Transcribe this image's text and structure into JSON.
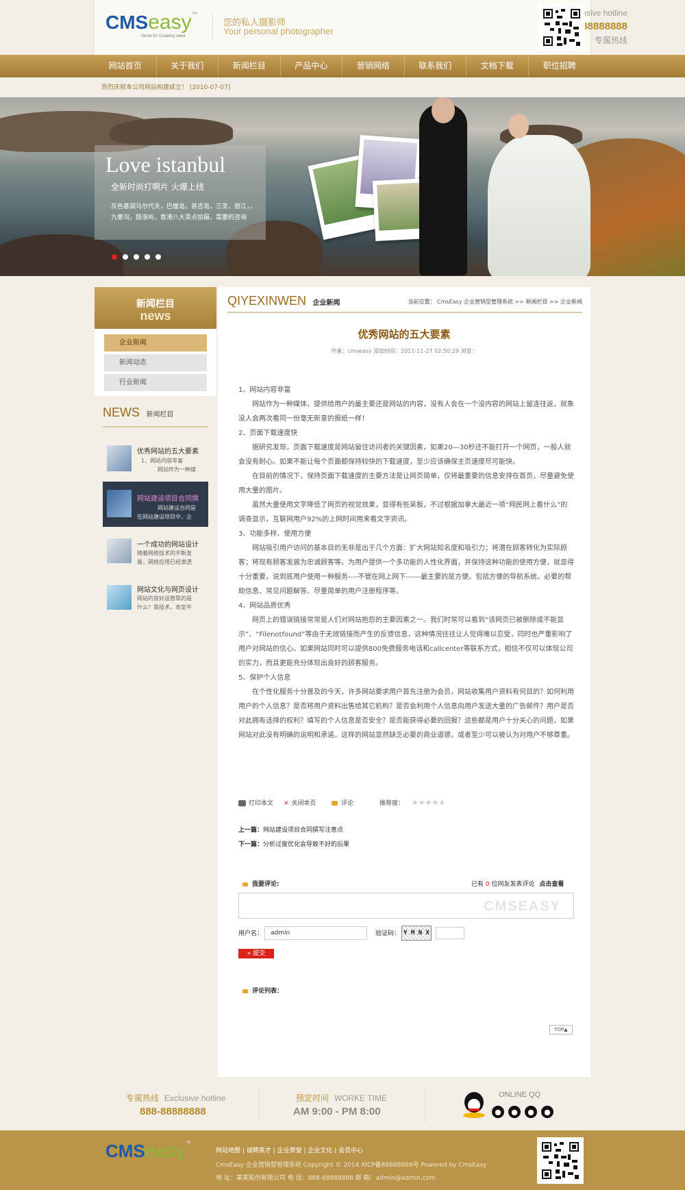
{
  "header": {
    "logo_main": "CMS",
    "logo_accent": "easy",
    "logo_tm": "™",
    "logo_tagline": "Serve for Creating value",
    "slogan_cn": "您的私人摄影师",
    "slogan_en": "Your personal photographer",
    "hotline_en": "Exclusive hotline",
    "hotline_number": "888-88888888",
    "hotline_cn": "专属热线"
  },
  "nav": {
    "items": [
      "网站首页",
      "关于我们",
      "新闻栏目",
      "产品中心",
      "营销网络",
      "联系我们",
      "文档下载",
      "职位招聘"
    ]
  },
  "announcement": "热烈庆祝本公司网站构建成立！ [2010-07-07]",
  "banner": {
    "title": "Love istanbul",
    "subtitle": "全新时尚打啊片 火爆上线",
    "desc1": "灰色基调马尔代夫，巴厘岛，普吉岛，三亚，丽江，，",
    "desc2": "九寨沟，鼓浪屿，香港八大景点拍摄，需要的咨询"
  },
  "sidebar": {
    "title_cn": "新闻栏目",
    "title_en": "news",
    "menu": [
      "企业新闻",
      "新闻动态",
      "行业新闻"
    ],
    "news_en": "NEWS",
    "news_cn": "新闻栏目",
    "news_items": [
      {
        "title": "优秀网站的五大要素",
        "line1": "1、网站内容非富",
        "line2": "网站作为一种媒"
      },
      {
        "title": "网站建设项目合同撰",
        "line1": "网站建设合同是",
        "line2": "在网站建设项目中，企"
      },
      {
        "title": "一个成功的网站设计",
        "line1": "随着网络技术的不断发",
        "line2": "展，网络应用已经渗透"
      },
      {
        "title": "网站文化与网页设计",
        "line1": "网站的良好运营靠的是",
        "line2": "什么？靠技术，肯定不"
      }
    ]
  },
  "content": {
    "heading_en": "QIYEXINWEN",
    "heading_cn": "企业新闻",
    "breadcrumb": "当前位置： CmsEasy 企业营销型管理系统  >> 新闻栏目  >> 企业新闻",
    "article_title": "优秀网站的五大要素",
    "meta": "作者：cmseasy   添加时间：2011-11-27 02:50:29   浏览：",
    "paragraphs": [
      "1、网站内容非富",
      "网站作为一种媒体，提供给用户的最主要还是网站的内容，没有人会在一个没内容的网站上留连往返，就象没人会两次看同一份毫无新意的报纸一样！",
      "2、页面下载速度快",
      "据研究发现，页面下载速度是网站留住访问者的关键因素，如果20—30秒还不能打开一个网页，一般人就会没有耐心。如果不能让每个页面都保持较快的下载速度，至少应该确保主页速度尽可能快。",
      "在目前的情况下，保持页面下载速度的主要方法是让网页简单，仅将最重要的信息安排在首页，尽量避免使用大量的图片。",
      "虽然大量使用文字降低了网页的视觉效果，显得有些呆板，不过根据加拿大最近一项“网民网上看什么”的调查显示，互联网用户92%的上网时间用来看文字资讯。",
      "3、功能多样、使用方便",
      "网站吸引用户访问的基本目的无非是出于几个方面：扩大网站知名度和吸引力；将潜在顾客转化为实际顾客；将现有顾客发展为忠诚顾客等。为用户提供一个多功能的人性化界面，并保持这种功能的使用方便，就显得十分重要，说到底用户使用一种服务----不管在网上网下------最主要的是方便。包括方便的导航系统、必要的帮助信息、常见问题解答、尽量简单的用户注册程序等。",
      "4、网站品质优秀",
      "网页上的错误链接常常是人们对网站抱怨的主要因素之一。我们时常可以看到“该网页已被删除或不能显示”、“Filenotfound”等由于无效链接而产生的反馈信息，这种情况往往让人觉得难以忍受，同时也严重影响了用户对网站的信心。如果网站同时可以提供800免费服务电话和callcenter等联系方式，相信不仅可以体现公司的实力，而且更能充分体现出良好的顾客服务。",
      "5、保护个人信息",
      "在个性化服务十分普及的今天，许多网站要求用户首先注册为会员，网站收集用户资料有何目的？如何利用用户的个人信息？是否将用户资料出售给其它机构？是否会利用个人信息向用户发送大量的广告邮件？用户是否对此拥有选择的权利？填写的个人信息是否安全？是否能获得必要的回报？这些都是用户十分关心的问题，如果网站对此没有明确的说明和承诺，这样的网站显然缺乏必要的商业道德，或者至少可以被认为对用户不够尊重。"
    ],
    "print_label": "打印本文",
    "close_label": "关闭本页",
    "comment_label": "评论",
    "recommend_label": "推荐度：",
    "prev_label": "上一篇：",
    "prev_title": "网站建设项目合同撰写注意点",
    "next_label": "下一篇：",
    "next_title": "分析过度优化会导致不好的后果",
    "my_comment": "我要评论:",
    "comment_count_pre": "已有",
    "comment_count": "0",
    "comment_count_post": "位网友发表评论",
    "view_link": "点击查看",
    "watermark": "CMSEASY",
    "username_label": "用户名：",
    "username_value": "admin",
    "captcha_label": "验证码：",
    "captcha_text": "Y M N X",
    "submit_label": "提交",
    "comment_list": "评论列表：",
    "top_label": "TOP▲"
  },
  "footer_hot": {
    "hotline_cn": "专属热线",
    "hotline_en": "Exclusive hotline",
    "hotline_number": "888-88888888",
    "time_cn": "预定时间",
    "time_en": "WORKE TIME",
    "time_value": "AM 9:00 - PM 8:00",
    "qq_label": "ONLINE QQ"
  },
  "footer": {
    "links": [
      "网站地图",
      "诚聘英才",
      "企业荣誉",
      "企业文化",
      "会员中心"
    ],
    "copyright": "CmsEasy 企业营销型管理系统  Copyright © 2014  XICP备88888888号  Powered by CmsEasy",
    "address": "地 址：某某股份有限公司  电 话：888-88888888  邮 箱：admin@admin.com"
  },
  "colors": {
    "gold": "#b99449",
    "gold_dark": "#8a6521",
    "nav_gradient_top": "#c9a05a",
    "title_brown": "#8a5a14",
    "red": "#d9231b"
  }
}
